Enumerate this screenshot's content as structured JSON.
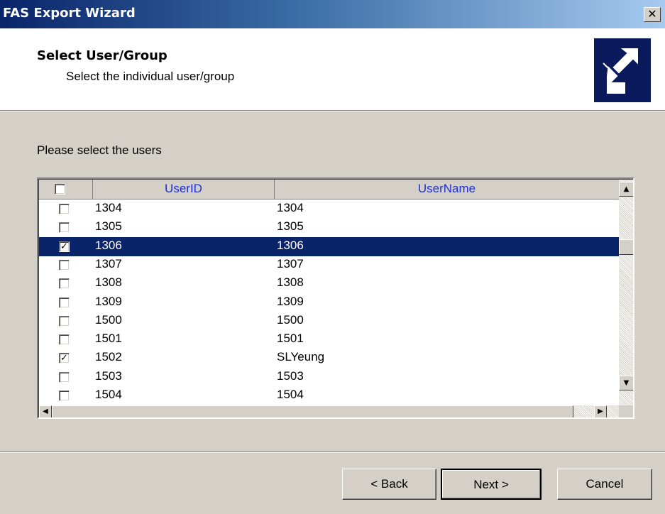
{
  "window": {
    "title": "FAS Export Wizard",
    "close_glyph": "✕"
  },
  "header": {
    "title": "Select User/Group",
    "subtitle": "Select the individual user/group",
    "icon": "export-arrows-icon"
  },
  "prompt": "Please select the users",
  "list": {
    "columns": [
      "UserID",
      "UserName"
    ],
    "select_all_checked": false,
    "rows": [
      {
        "id": "1304",
        "name": "1304",
        "checked": false,
        "selected": false
      },
      {
        "id": "1305",
        "name": "1305",
        "checked": false,
        "selected": false
      },
      {
        "id": "1306",
        "name": "1306",
        "checked": true,
        "selected": true
      },
      {
        "id": "1307",
        "name": "1307",
        "checked": false,
        "selected": false
      },
      {
        "id": "1308",
        "name": "1308",
        "checked": false,
        "selected": false
      },
      {
        "id": "1309",
        "name": "1309",
        "checked": false,
        "selected": false
      },
      {
        "id": "1500",
        "name": "1500",
        "checked": false,
        "selected": false
      },
      {
        "id": "1501",
        "name": "1501",
        "checked": false,
        "selected": false
      },
      {
        "id": "1502",
        "name": "SLYeung",
        "checked": true,
        "selected": false
      },
      {
        "id": "1503",
        "name": "1503",
        "checked": false,
        "selected": false
      },
      {
        "id": "1504",
        "name": "1504",
        "checked": false,
        "selected": false
      }
    ]
  },
  "buttons": {
    "back": "< Back",
    "next": "Next >",
    "cancel": "Cancel"
  },
  "colors": {
    "selection": "#0a246a",
    "header_text": "#1f2fcf",
    "dialog_bg": "#d4d0c8"
  }
}
